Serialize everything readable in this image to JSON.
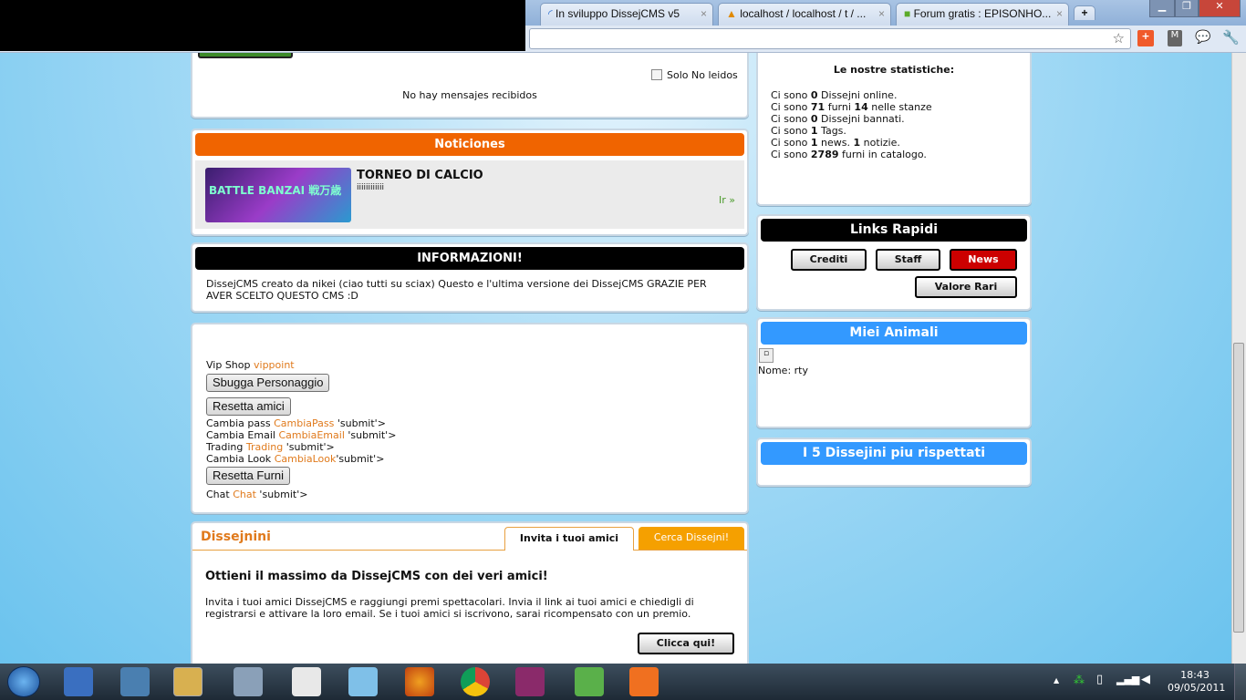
{
  "browser": {
    "tabs": [
      {
        "label": "In sviluppo DissejCMS v5"
      },
      {
        "label": "localhost / localhost / t / ..."
      },
      {
        "label": "Forum gratis : EPISONHO..."
      }
    ],
    "new_tab": "+",
    "icons": [
      "star-icon",
      "addon-plus-icon",
      "shield-m-icon",
      "chat-icon",
      "wrench-icon"
    ]
  },
  "messages": {
    "filter_label": "Solo No leidos",
    "empty": "No hay mensajes recibidos"
  },
  "news": {
    "title": "Noticiones",
    "image_text": "BATTLE BANZAI 戦万歳",
    "item_title": "TORNEO DI CALCIO",
    "item_text": "iiiiiiiiiiii",
    "go": "Ir »"
  },
  "info": {
    "title": "INFORMAZIONI!",
    "text": "DissejCMS creato da nikei (ciao tutti su sciax) Questo e l'ultima versione dei DissejCMS GRAZIE PER AVER SCELTO QUESTO CMS :D"
  },
  "vip": {
    "shop_label": "Vip Shop",
    "shop_link": "vippoint",
    "btn_sbugga": "Sbugga Personaggio",
    "btn_resetta_amici": "Resetta amici",
    "rows": [
      {
        "label": "Cambia pass",
        "link": "CambiaPass",
        "tail": " 'submit'>"
      },
      {
        "label": "Cambia Email",
        "link": "CambiaEmail",
        "tail": " 'submit'>"
      },
      {
        "label": "Trading",
        "link": "Trading",
        "tail": " 'submit'>"
      },
      {
        "label": "Cambia Look",
        "link": "CambiaLook",
        "tail": "'submit'>"
      }
    ],
    "btn_resetta_furni": "Resetta Furni",
    "chat_label": "Chat",
    "chat_link": "Chat",
    "chat_tail": " 'submit'>"
  },
  "friends": {
    "title": "Dissejnini",
    "tab_active": "Invita i tuoi amici",
    "tab_other": "Cerca Dissejni!",
    "heading": "Ottieni il massimo da DissejCMS con dei veri amici!",
    "text": "Invita i tuoi amici DissejCMS e raggiungi premi spettacolari. Invia il link ai tuoi amici e chiedigli di registrarsi e attivare la loro email. Se i tuoi amici si iscrivono, sarai ricompensato con un premio.",
    "button": "Clicca qui!"
  },
  "stats": {
    "title": "Le nostre statistiche:",
    "prefix": "Ci sono ",
    "rows": [
      [
        "0",
        " Dissejni online.",
        "",
        ""
      ],
      [
        "71",
        " furni ",
        "14",
        " nelle stanze"
      ],
      [
        "0",
        " Dissejni bannati.",
        "",
        ""
      ],
      [
        "1",
        " Tags.",
        "",
        ""
      ],
      [
        "1",
        " news. ",
        "1",
        " notizie."
      ],
      [
        "2789",
        " furni in catalogo.",
        "",
        ""
      ]
    ]
  },
  "links": {
    "title": "Links Rapidi",
    "crediti": "Crediti",
    "staff": "Staff",
    "news": "News",
    "valore": "Valore Rari"
  },
  "pets": {
    "title": "Miei Animali",
    "name": "Nome: rty"
  },
  "top5": {
    "title": "I 5 Dissejini piu rispettati"
  },
  "taskbar": {
    "time": "18:43",
    "date": "09/05/2011"
  },
  "colors": {
    "orange": "#f06400",
    "blue": "#3399ff",
    "red": "#cc0000",
    "link": "#e07a1c"
  }
}
